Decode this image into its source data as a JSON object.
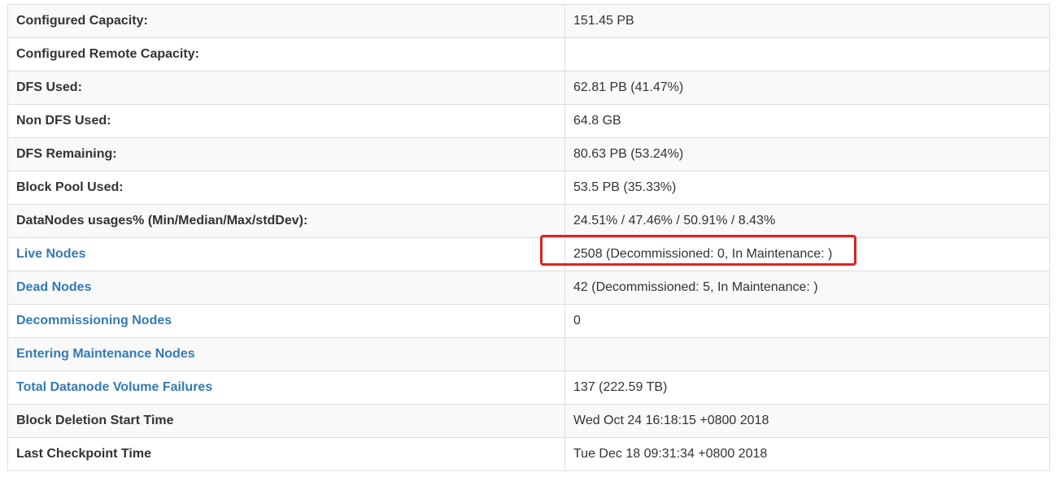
{
  "summary": {
    "rows": [
      {
        "label": "Configured Capacity:",
        "value": "151.45 PB",
        "link": false
      },
      {
        "label": "Configured Remote Capacity:",
        "value": "",
        "link": false
      },
      {
        "label": "DFS Used:",
        "value": "62.81 PB (41.47%)",
        "link": false
      },
      {
        "label": "Non DFS Used:",
        "value": "64.8 GB",
        "link": false
      },
      {
        "label": "DFS Remaining:",
        "value": "80.63 PB (53.24%)",
        "link": false
      },
      {
        "label": "Block Pool Used:",
        "value": "53.5 PB (35.33%)",
        "link": false
      },
      {
        "label": "DataNodes usages% (Min/Median/Max/stdDev):",
        "value": "24.51% / 47.46% / 50.91% / 8.43%",
        "link": false
      },
      {
        "label": "Live Nodes",
        "value": "2508 (Decommissioned: 0, In Maintenance: )",
        "link": true
      },
      {
        "label": "Dead Nodes",
        "value": "42 (Decommissioned: 5, In Maintenance: )",
        "link": true
      },
      {
        "label": "Decommissioning Nodes",
        "value": "0",
        "link": true
      },
      {
        "label": "Entering Maintenance Nodes",
        "value": "",
        "link": true
      },
      {
        "label": "Total Datanode Volume Failures",
        "value": "137 (222.59 TB)",
        "link": true
      },
      {
        "label": "Block Deletion Start Time",
        "value": "Wed Oct 24 16:18:15 +0800 2018",
        "link": false
      },
      {
        "label": "Last Checkpoint Time",
        "value": "Tue Dec 18 09:31:34 +0800 2018",
        "link": false
      }
    ]
  },
  "colors": {
    "link": "#337ab7",
    "highlight": "#e0211f",
    "border": "#dddddd",
    "stripe": "#f9f9f9"
  }
}
